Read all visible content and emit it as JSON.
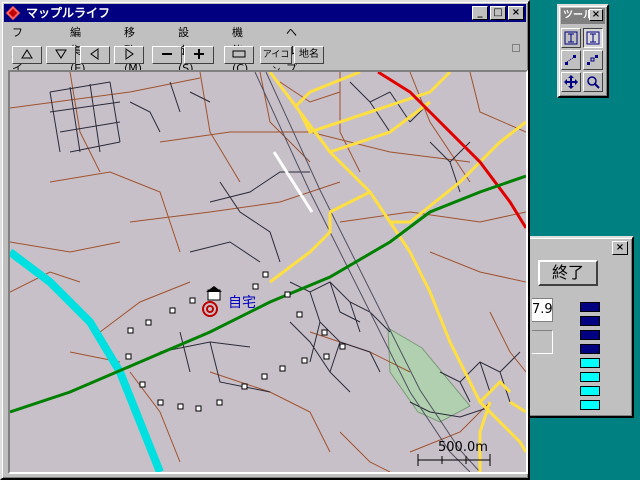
{
  "main_window": {
    "title": "マップルライフ",
    "menu": [
      "ファイル(F)",
      "編集(E)",
      "移動(M)",
      "設定(S)",
      "機能(C)",
      "ヘルプ(H)"
    ],
    "toolbar": {
      "icon_label": "アイコン",
      "map_label": "地名"
    },
    "controls": {
      "minimize": "_",
      "maximize": "□",
      "close": "×"
    }
  },
  "map": {
    "home_label": "自宅",
    "scale_label": "500.0m"
  },
  "tool_window": {
    "title": "ツール",
    "close": "×",
    "tools": [
      "text-cursor",
      "text-cursor-alt",
      "route-a",
      "route-b",
      "move",
      "zoom"
    ]
  },
  "side_panel": {
    "close": "×",
    "end_button": "終了",
    "value": "7.9",
    "swatches": [
      "#000080",
      "#000080",
      "#000080",
      "#000080",
      "#00ffff",
      "#00ffff",
      "#00ffff",
      "#00ffff"
    ]
  },
  "colors": {
    "title_active": "#000080",
    "map_bg": "#c8c0c8",
    "rail_green": "#008000",
    "road_yellow": "#ffe040",
    "road_red": "#e00000",
    "river_cyan": "#00e0e0",
    "park": "#b0d0b0"
  }
}
